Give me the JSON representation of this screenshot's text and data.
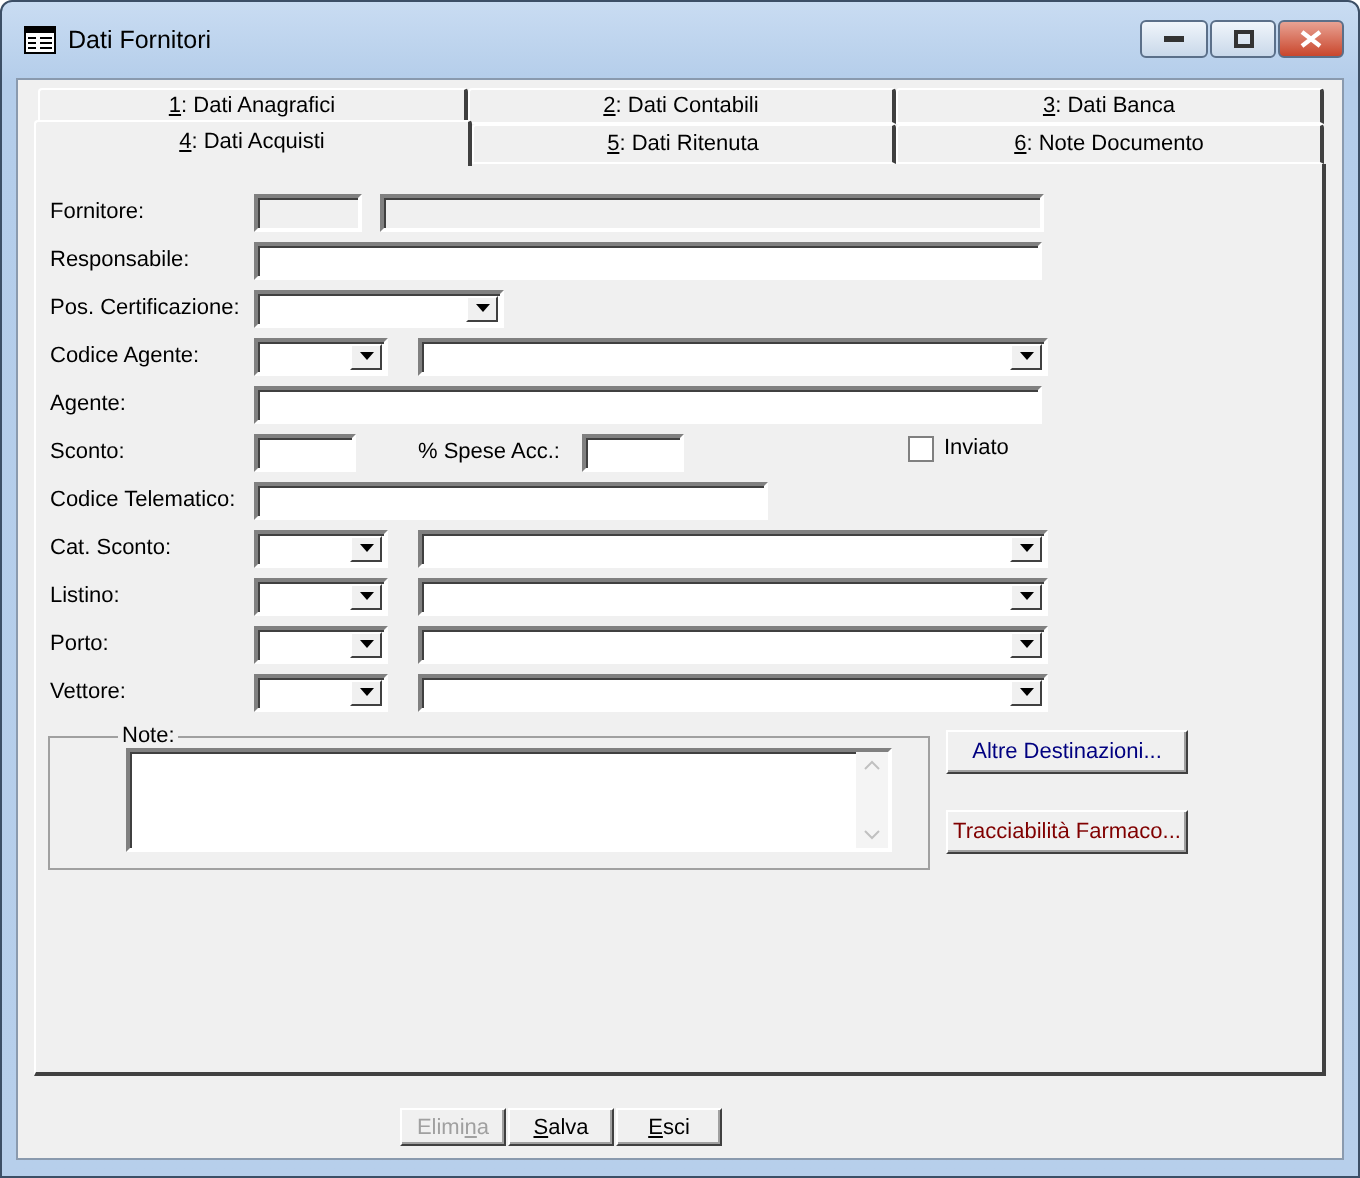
{
  "window": {
    "title": "Dati Fornitori"
  },
  "tab_rows": [
    [
      {
        "key": "1",
        "rest": ": Dati Anagrafici",
        "selected": false
      },
      {
        "key": "2",
        "rest": ": Dati Contabili",
        "selected": false
      },
      {
        "key": "3",
        "rest": ": Dati Banca",
        "selected": false
      }
    ],
    [
      {
        "key": "4",
        "rest": ": Dati Acquisti",
        "selected": true
      },
      {
        "key": "5",
        "rest": ": Dati Ritenuta",
        "selected": false
      },
      {
        "key": "6",
        "rest": ": Note Documento",
        "selected": false
      }
    ]
  ],
  "rows": [
    {
      "kind": "locked_pair",
      "label": "Fornitore:",
      "disabled": true
    },
    {
      "kind": "text",
      "label": "Responsabile:"
    },
    {
      "kind": "combo",
      "label": "Pos. Certificazione:"
    },
    {
      "kind": "combo_pair",
      "label": "Codice Agente:"
    },
    {
      "kind": "text",
      "label": "Agente:"
    },
    {
      "kind": "sconto",
      "label": "Sconto:",
      "extra_label": "% Spese Acc.:",
      "checkbox": {
        "label": "Inviato",
        "checked": false
      }
    },
    {
      "kind": "code",
      "label": "Codice Telematico:"
    },
    {
      "kind": "combo_pair",
      "label": "Cat. Sconto:"
    },
    {
      "kind": "combo_pair",
      "label": "Listino:"
    },
    {
      "kind": "combo_pair",
      "label": "Porto:"
    },
    {
      "kind": "combo_pair",
      "label": "Vettore:"
    }
  ],
  "note": {
    "label": "Note:"
  },
  "side_buttons": [
    {
      "label": "Altre Destinazioni...",
      "color": "#000080"
    },
    {
      "label": "Tracciabilità Farmaco...",
      "color": "#800000"
    }
  ],
  "buttons": [
    {
      "pre": "Elimi",
      "key": "n",
      "post": "a",
      "disabled": true
    },
    {
      "key": "S",
      "post": "alva",
      "disabled": false
    },
    {
      "key": "E",
      "post": "sci",
      "disabled": false
    }
  ]
}
